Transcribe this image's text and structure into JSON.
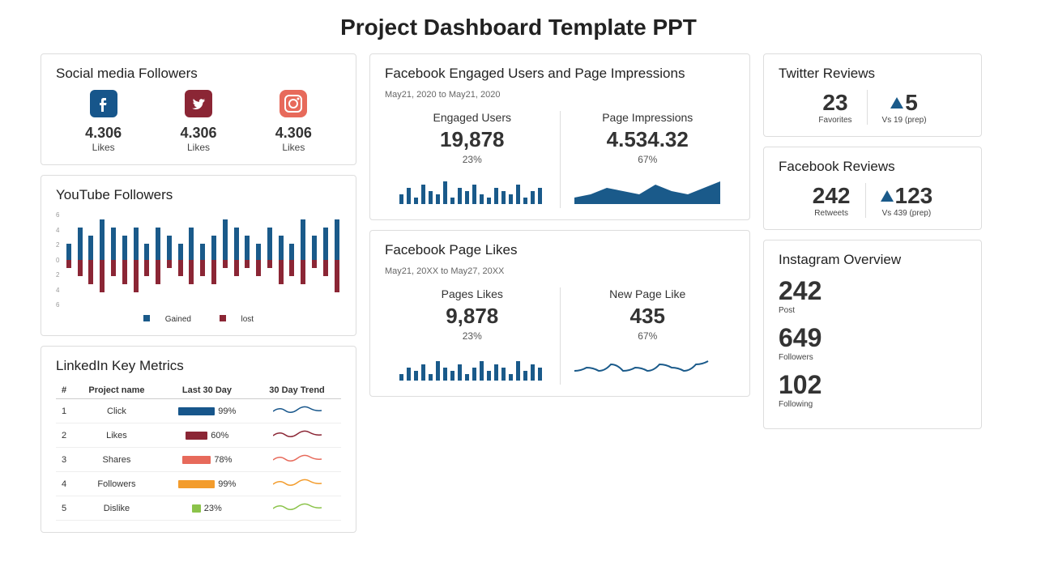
{
  "title": "Project Dashboard Template PPT",
  "social": {
    "title": "Social media Followers",
    "items": [
      {
        "value": "4.306",
        "label": "Likes",
        "icon": "facebook",
        "color": "#17568b"
      },
      {
        "value": "4.306",
        "label": "Likes",
        "icon": "twitter",
        "color": "#8b2635"
      },
      {
        "value": "4.306",
        "label": "Likes",
        "icon": "instagram",
        "color": "#e76a5b"
      }
    ]
  },
  "youtube": {
    "title": "YouTube Followers",
    "legend": {
      "gained": "Gained",
      "lost": "lost"
    },
    "axis": [
      "6",
      "4",
      "2",
      "0",
      "2",
      "4",
      "6"
    ]
  },
  "linkedin": {
    "title": "LinkedIn Key Metrics",
    "headers": [
      "#",
      "Project name",
      "Last 30 Day",
      "30 Day Trend"
    ],
    "rows": [
      {
        "n": "1",
        "name": "Click",
        "pct": "99%",
        "color": "#17568b",
        "trend": "#17568b"
      },
      {
        "n": "2",
        "name": "Likes",
        "pct": "60%",
        "color": "#8b2635",
        "trend": "#8b2635"
      },
      {
        "n": "3",
        "name": "Shares",
        "pct": "78%",
        "color": "#e76a5b",
        "trend": "#e76a5b"
      },
      {
        "n": "4",
        "name": "Followers",
        "pct": "99%",
        "color": "#f39c2c",
        "trend": "#f39c2c"
      },
      {
        "n": "5",
        "name": "Dislike",
        "pct": "23%",
        "color": "#8bc34a",
        "trend": "#8bc34a"
      }
    ]
  },
  "fbEngaged": {
    "title": "Facebook Engaged Users and Page Impressions",
    "range": "May21, 2020 to May21, 2020",
    "left": {
      "label": "Engaged Users",
      "value": "19,878",
      "pct": "23%"
    },
    "right": {
      "label": "Page Impressions",
      "value": "4.534.32",
      "pct": "67%"
    }
  },
  "fbLikes": {
    "title": "Facebook Page Likes",
    "range": "May21, 20XX to May27, 20XX",
    "left": {
      "label": "Pages Likes",
      "value": "9,878",
      "pct": "23%"
    },
    "right": {
      "label": "New Page Like",
      "value": "435",
      "pct": "67%"
    }
  },
  "twitter": {
    "title": "Twitter Reviews",
    "fav": {
      "value": "23",
      "label": "Favorites"
    },
    "delta": {
      "value": "5",
      "label": "Vs 19 (prep)"
    }
  },
  "fbReviews": {
    "title": "Facebook Reviews",
    "rt": {
      "value": "242",
      "label": "Retweets"
    },
    "delta": {
      "value": "123",
      "label": "Vs 439 (prep)"
    }
  },
  "instagram": {
    "title": "Instagram Overview",
    "stats": [
      {
        "value": "242",
        "label": "Post"
      },
      {
        "value": "649",
        "label": "Followers"
      },
      {
        "value": "102",
        "label": "Following"
      }
    ]
  },
  "chart_data": {
    "youtube_followers": {
      "type": "bar",
      "title": "YouTube Followers",
      "ylim": [
        -6,
        6
      ],
      "series": [
        {
          "name": "Gained",
          "values": [
            2,
            4,
            3,
            5,
            4,
            3,
            4,
            2,
            4,
            3,
            2,
            4,
            2,
            3,
            5,
            4,
            3,
            2,
            4,
            3,
            2,
            5,
            3,
            4,
            5
          ]
        },
        {
          "name": "lost",
          "values": [
            -1,
            -2,
            -3,
            -4,
            -2,
            -3,
            -4,
            -2,
            -3,
            -1,
            -2,
            -3,
            -2,
            -3,
            -1,
            -2,
            -1,
            -2,
            -1,
            -3,
            -2,
            -3,
            -1,
            -2,
            -4
          ]
        }
      ]
    },
    "linkedin_metrics": {
      "type": "table",
      "rows": [
        {
          "name": "Click",
          "last30": 99
        },
        {
          "name": "Likes",
          "last30": 60
        },
        {
          "name": "Shares",
          "last30": 78
        },
        {
          "name": "Followers",
          "last30": 99
        },
        {
          "name": "Dislike",
          "last30": 23
        }
      ]
    },
    "engaged_users_spark": {
      "type": "bar",
      "values": [
        3,
        5,
        2,
        6,
        4,
        3,
        7,
        2,
        5,
        4,
        6,
        3,
        2,
        5,
        4,
        3,
        6,
        2,
        4,
        5
      ]
    },
    "page_impressions_spark": {
      "type": "area",
      "values": [
        2,
        3,
        5,
        4,
        3,
        6,
        4,
        3,
        5,
        7
      ]
    },
    "pages_likes_spark": {
      "type": "bar",
      "values": [
        2,
        4,
        3,
        5,
        2,
        6,
        4,
        3,
        5,
        2,
        4,
        6,
        3,
        5,
        4,
        2,
        6,
        3,
        5,
        4
      ]
    },
    "new_page_like_spark": {
      "type": "line",
      "values": [
        3,
        4,
        3,
        5,
        3,
        4,
        3,
        5,
        4,
        3,
        5,
        6
      ]
    }
  }
}
